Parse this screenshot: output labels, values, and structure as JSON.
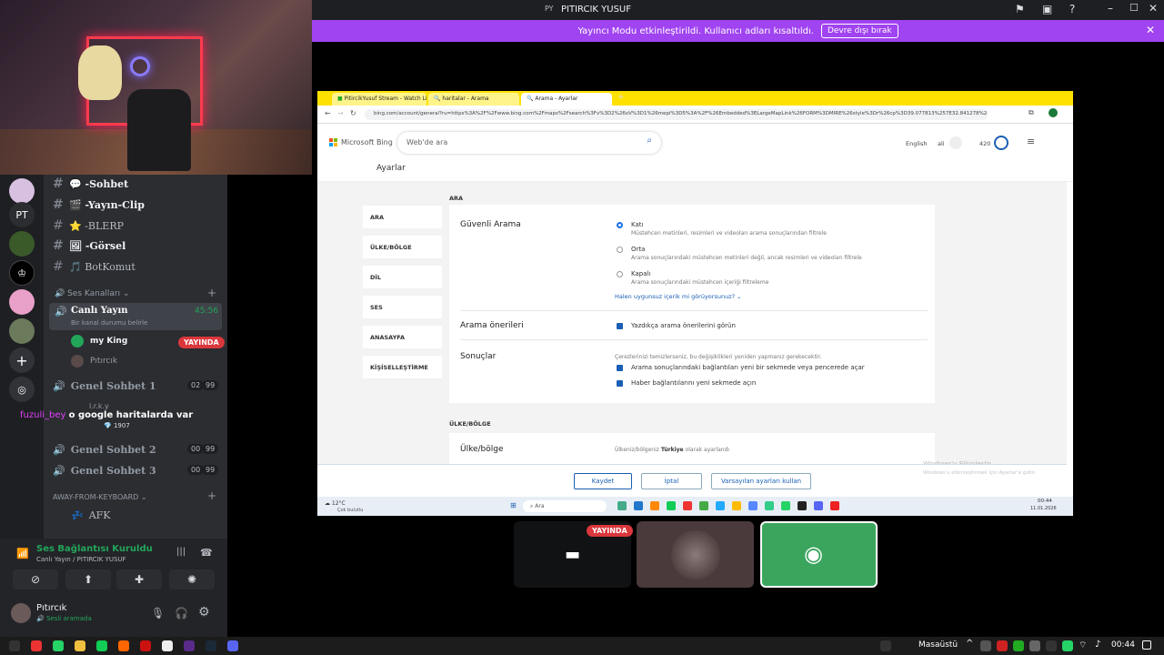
{
  "titlebar": {
    "avatar": "PY",
    "title": "PITIRCIK YUSUF"
  },
  "banner": {
    "message": "Yayıncı Modu etkinleştirildi. Kullanıcı adları kısaltıldı.",
    "button": "Devre dışı bırak"
  },
  "servers": {
    "items": [
      "PT"
    ]
  },
  "channels": {
    "text": [
      {
        "icon": "💬",
        "name": "-Sohbet"
      },
      {
        "icon": "🎬",
        "name": "-Yayın-Clip"
      },
      {
        "icon": "⭐",
        "name": "-BLERP"
      },
      {
        "icon": "🖼",
        "name": "-Görsel"
      },
      {
        "icon": "🎵",
        "name": "BotKomut"
      }
    ],
    "voice_category": "Ses Kanalları",
    "live_channel": {
      "name": "Canlı Yayın",
      "time": "45:56",
      "status": "Bir kanal durumu belirle"
    },
    "live_users": [
      {
        "name": "my King",
        "badge": "YAYINDA"
      },
      {
        "name": "Pıtırcık"
      }
    ],
    "genel1": {
      "name": "Genel Sohbet 1",
      "count1": "02",
      "count2": "99"
    },
    "chat_overlay": {
      "user": "fuzuli_bey",
      "message": "o google haritalarda var",
      "small_user": "l.r.k.y",
      "small_count": "1907"
    },
    "genel2": {
      "name": "Genel Sohbet 2",
      "count1": "00",
      "count2": "99"
    },
    "genel3": {
      "name": "Genel Sohbet 3",
      "count1": "00",
      "count2": "99"
    },
    "afk_category": "AWAY-FROM-KEYBOARD",
    "afk": "AFK"
  },
  "voice_status": {
    "title": "Ses Bağlantısı Kuruldu",
    "subtitle": "Canlı Yayın / PITIRCIK YUSUF"
  },
  "user": {
    "name": "Pıtırcık",
    "status": "Sesli aramada"
  },
  "browser": {
    "tabs": [
      "PitircikYusuf Stream - Watch Li",
      "haritalar - Arama",
      "Arama - Ayarlar"
    ],
    "url": "bing.com/account/general?ru=https%3A%2F%2Fwww.bing.com%2Fmaps%2Fsearch%3Fv%3D2%26oV%3D1%26mepi%3D5%3A%2F%26Embedded%3ELargeMapLink%26FORM%3DMIRE%26style%3Dr%26cp%3D39.077813%257E32.841278%26lv..."
  },
  "bing": {
    "logo": "Microsoft Bing",
    "search_placeholder": "Web'de ara",
    "lang": "English",
    "user": "ali",
    "points": "420",
    "page_title": "Ayarlar",
    "nav": [
      "ARA",
      "ÜLKE/BÖLGE",
      "DİL",
      "SES",
      "ANASAYFA",
      "KİŞİSELLEŞTİRME"
    ],
    "section1": "ARA",
    "safe_search": {
      "label": "Güvenli Arama",
      "options": [
        {
          "title": "Katı",
          "desc": "Müstehcen metinleri, resimleri ve videoları arama sonuçlarından filtrele"
        },
        {
          "title": "Orta",
          "desc": "Arama sonuçlarındaki müstehcen metinleri değil, ancak resimleri ve videoları filtrele"
        },
        {
          "title": "Kapalı",
          "desc": "Arama sonuçlarındaki müstehcen içeriği filtreleme"
        }
      ],
      "link": "Halen uygunsuz içerik mi görüyorsunuz?"
    },
    "suggestions": {
      "label": "Arama önerileri",
      "option": "Yazdıkça arama önerilerini görün"
    },
    "results": {
      "label": "Sonuçlar",
      "note": "Çerezlerinizi temizlerseniz, bu değişiklikleri yeniden yapmanız gerekecektir.",
      "options": [
        "Arama sonuçlarındaki bağlantıları yeni bir sekmede veya pencerede açar",
        "Haber bağlantılarını yeni sekmede açın"
      ]
    },
    "section2": "ÜLKE/BÖLGE",
    "region": {
      "label": "Ülke/bölge",
      "prefix": "Ülkeniz/bölgeniz ",
      "value": "Türkiye",
      "suffix": " olarak ayarlandı"
    },
    "buttons": {
      "save": "Kaydet",
      "cancel": "İptal",
      "defaults": "Varsayılan ayarları kullan"
    },
    "watermark": {
      "line1": "Windows'u Etkinleştir",
      "line2": "Windows'u etkinleştirmek için Ayarlar'a gidin"
    }
  },
  "inner_taskbar": {
    "search": "Ara",
    "weather": "12°C",
    "weather_desc": "Çok bulutlu",
    "time": "00:44",
    "date": "11.01.2026"
  },
  "tiles": {
    "live_badge": "YAYINDA"
  },
  "taskbar": {
    "desktop": "Masaüstü",
    "time": "00:44"
  }
}
